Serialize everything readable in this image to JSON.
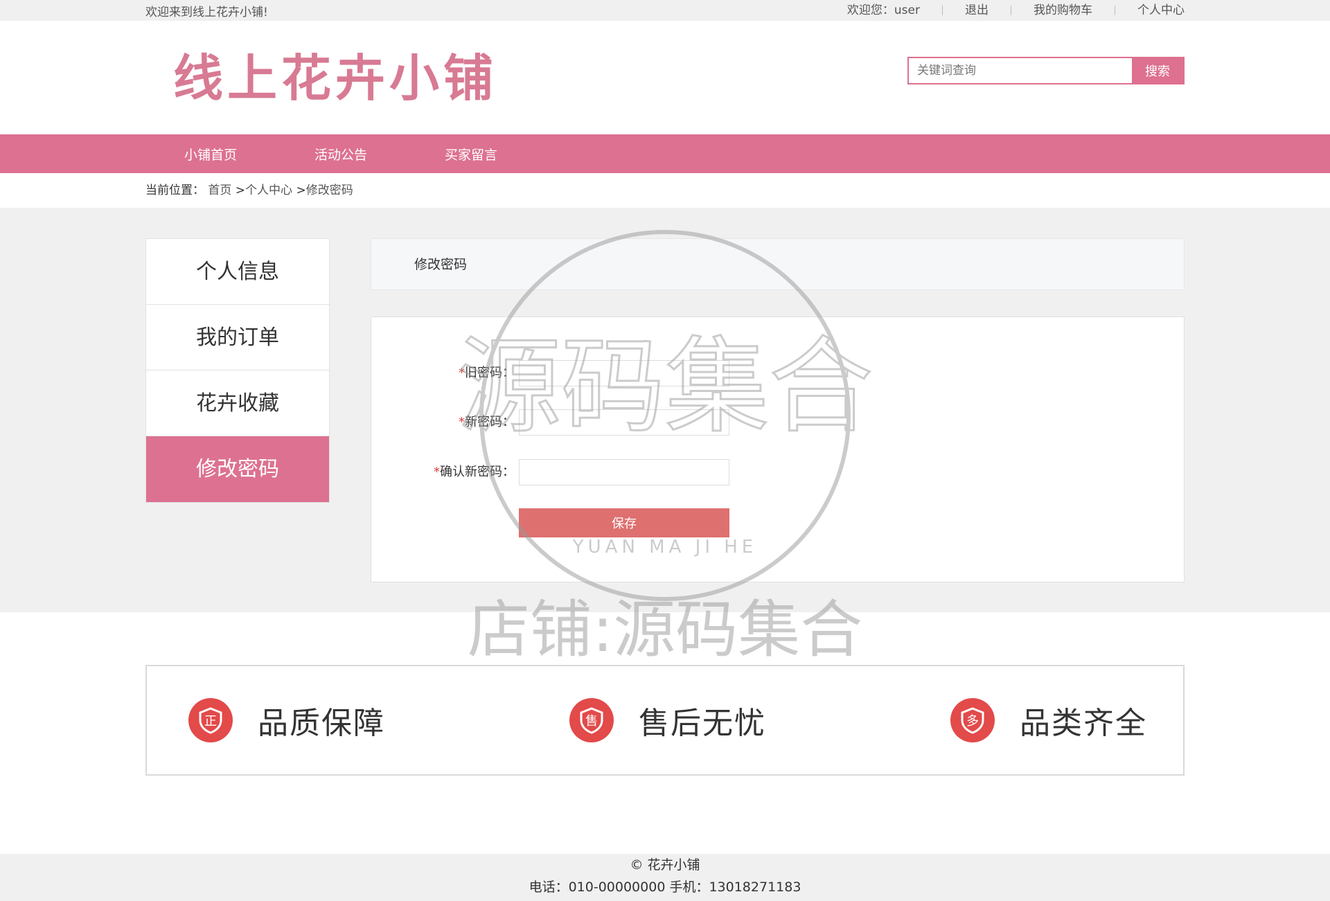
{
  "topbar": {
    "welcome": "欢迎来到线上花卉小铺!",
    "user_greeting": "欢迎您：user",
    "logout": "退出",
    "cart": "我的购物车",
    "center": "个人中心"
  },
  "header": {
    "logo_text": "线上花卉小铺",
    "search_placeholder": "关键词查询",
    "search_button": "搜索"
  },
  "nav": {
    "items": [
      "小铺首页",
      "活动公告",
      "买家留言"
    ]
  },
  "breadcrumb": {
    "label": "当前位置：",
    "home": "首页",
    "sep1": " >",
    "center": "个人中心",
    "sep2": " >",
    "current": "修改密码"
  },
  "sidebar": {
    "items": [
      "个人信息",
      "我的订单",
      "花卉收藏",
      "修改密码"
    ],
    "active": "修改密码"
  },
  "panel": {
    "title": "修改密码",
    "required_mark": "*",
    "fields": [
      {
        "label": "旧密码：",
        "value": ""
      },
      {
        "label": "新密码：",
        "value": ""
      },
      {
        "label": "确认新密码：",
        "value": ""
      }
    ],
    "save_button": "保存"
  },
  "features": [
    {
      "icon_char": "正",
      "icon": "quality-shield-icon",
      "text": "品质保障"
    },
    {
      "icon_char": "售",
      "icon": "after-sales-shield-icon",
      "text": "售后无忧"
    },
    {
      "icon_char": "多",
      "icon": "variety-shield-icon",
      "text": "品类齐全"
    }
  ],
  "footer": {
    "copyright": "© 花卉小铺",
    "contact": "电话：010-00000000 手机：13018271183"
  },
  "watermark": {
    "line1": "源码集合",
    "romanized": "YUAN MA JI HE",
    "shop": "店铺:源码集合"
  },
  "colors": {
    "accent": "#dd7191",
    "save": "#de7070",
    "feature_icon": "#e34a4a"
  }
}
